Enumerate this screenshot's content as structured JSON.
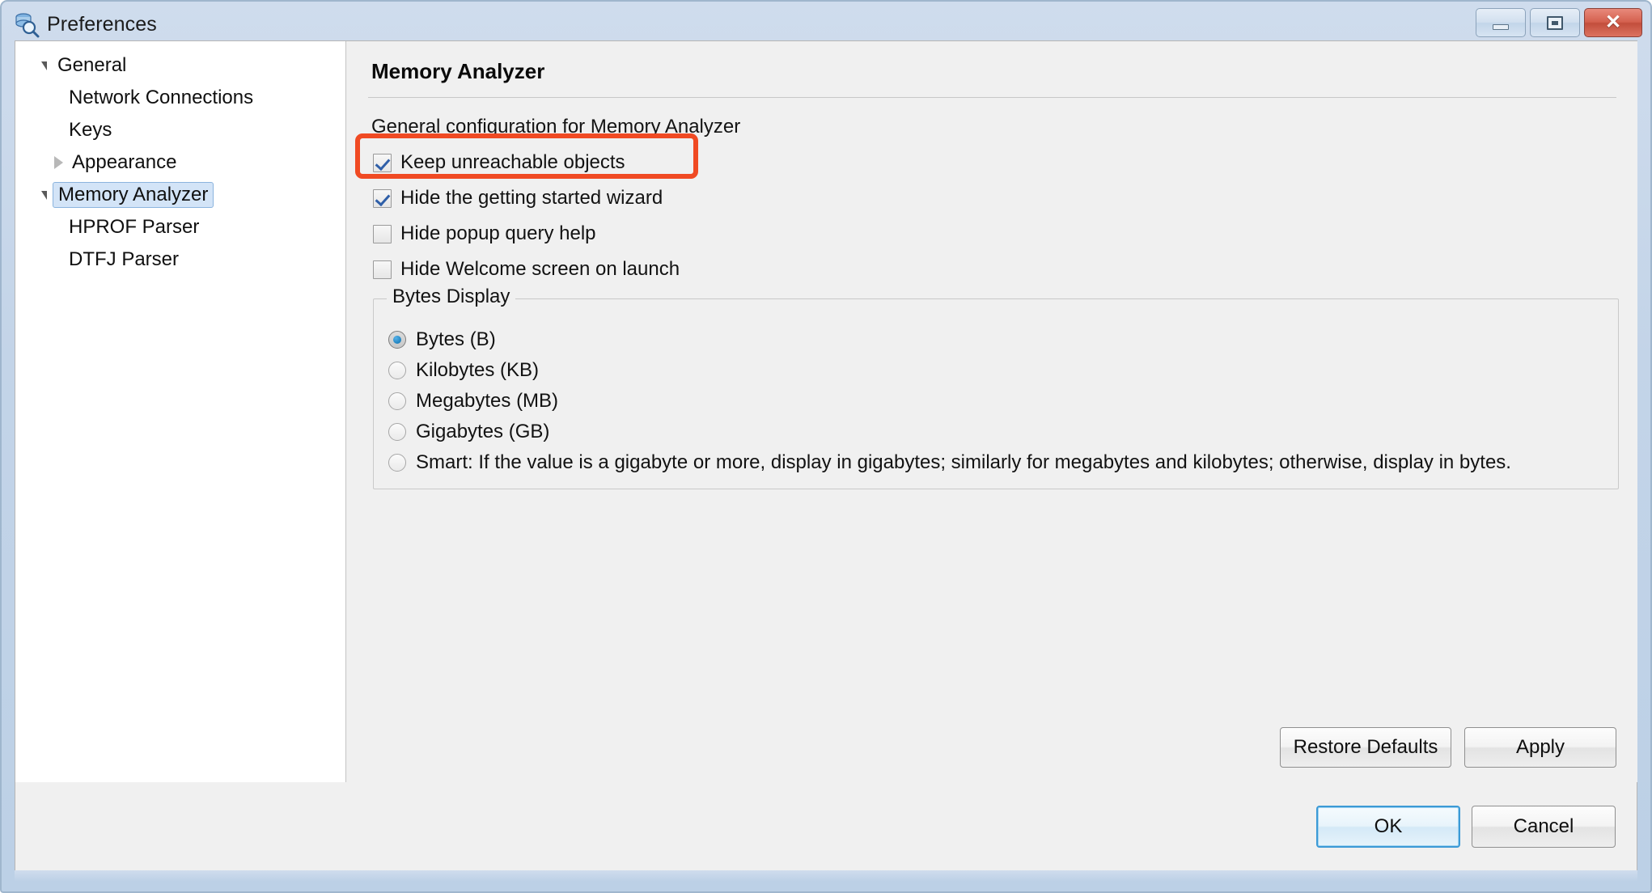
{
  "window": {
    "title": "Preferences",
    "icon": "preferences-search-icon",
    "controls": {
      "minimize": "minimize-icon",
      "restore": "restore-icon",
      "close": "close-icon"
    }
  },
  "sidebar": {
    "items": [
      {
        "label": "General",
        "indent": 0,
        "twisty": "down",
        "selected": false
      },
      {
        "label": "Network Connections",
        "indent": 1,
        "twisty": "none",
        "selected": false
      },
      {
        "label": "Keys",
        "indent": 1,
        "twisty": "none",
        "selected": false
      },
      {
        "label": "Appearance",
        "indent": 1,
        "twisty": "right",
        "selected": false
      },
      {
        "label": "Memory Analyzer",
        "indent": 0,
        "twisty": "down",
        "selected": true
      },
      {
        "label": "HPROF Parser",
        "indent": 1,
        "twisty": "none",
        "selected": false
      },
      {
        "label": "DTFJ Parser",
        "indent": 1,
        "twisty": "none",
        "selected": false
      }
    ]
  },
  "page": {
    "title": "Memory Analyzer",
    "description": "General configuration for Memory Analyzer",
    "checkboxes": [
      {
        "label": "Keep unreachable objects",
        "checked": true
      },
      {
        "label": "Hide the getting started wizard",
        "checked": true
      },
      {
        "label": "Hide popup query help",
        "checked": false
      },
      {
        "label": "Hide Welcome screen on launch",
        "checked": false
      }
    ],
    "bytes_display": {
      "legend": "Bytes Display",
      "options": [
        {
          "label": "Bytes (B)",
          "selected": true
        },
        {
          "label": "Kilobytes (KB)",
          "selected": false
        },
        {
          "label": "Megabytes (MB)",
          "selected": false
        },
        {
          "label": "Gigabytes (GB)",
          "selected": false
        },
        {
          "label": "Smart: If the value is a gigabyte or more, display in gigabytes; similarly for megabytes and kilobytes; otherwise, display in bytes.",
          "selected": false
        }
      ]
    },
    "buttons": {
      "restore_defaults": "Restore Defaults",
      "apply": "Apply"
    }
  },
  "footer": {
    "ok": "OK",
    "cancel": "Cancel"
  },
  "annotation": {
    "color": "#f04a23",
    "target": "Keep unreachable objects"
  }
}
